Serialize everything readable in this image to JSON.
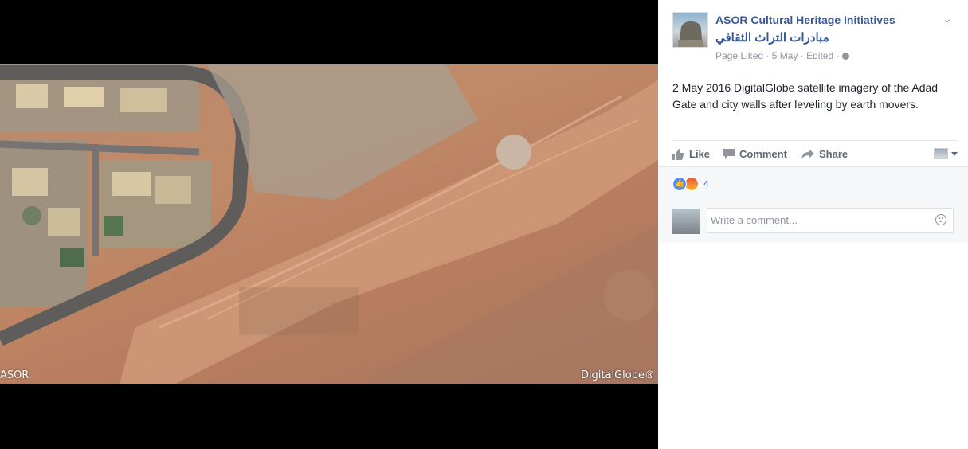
{
  "photo": {
    "watermark_left": "ASOR",
    "watermark_right": "DigitalGlobe®"
  },
  "post": {
    "page_name": "ASOR Cultural Heritage Initiatives",
    "page_name_arabic": "مبادرات التراث الثقافي",
    "meta": {
      "liked": "Page Liked",
      "date": "5 May",
      "edited": "Edited",
      "separator": "·"
    },
    "text": "2 May 2016 DigitalGlobe satellite imagery of the Adad Gate and city walls after leveling by earth movers."
  },
  "actions": {
    "like": "Like",
    "comment": "Comment",
    "share": "Share"
  },
  "reactions": {
    "count": "4"
  },
  "comment_box": {
    "placeholder": "Write a comment..."
  },
  "icons": [
    "chevron-down-icon",
    "globe-icon",
    "like-icon",
    "comment-icon",
    "share-icon",
    "caret-icon",
    "smile-icon"
  ]
}
